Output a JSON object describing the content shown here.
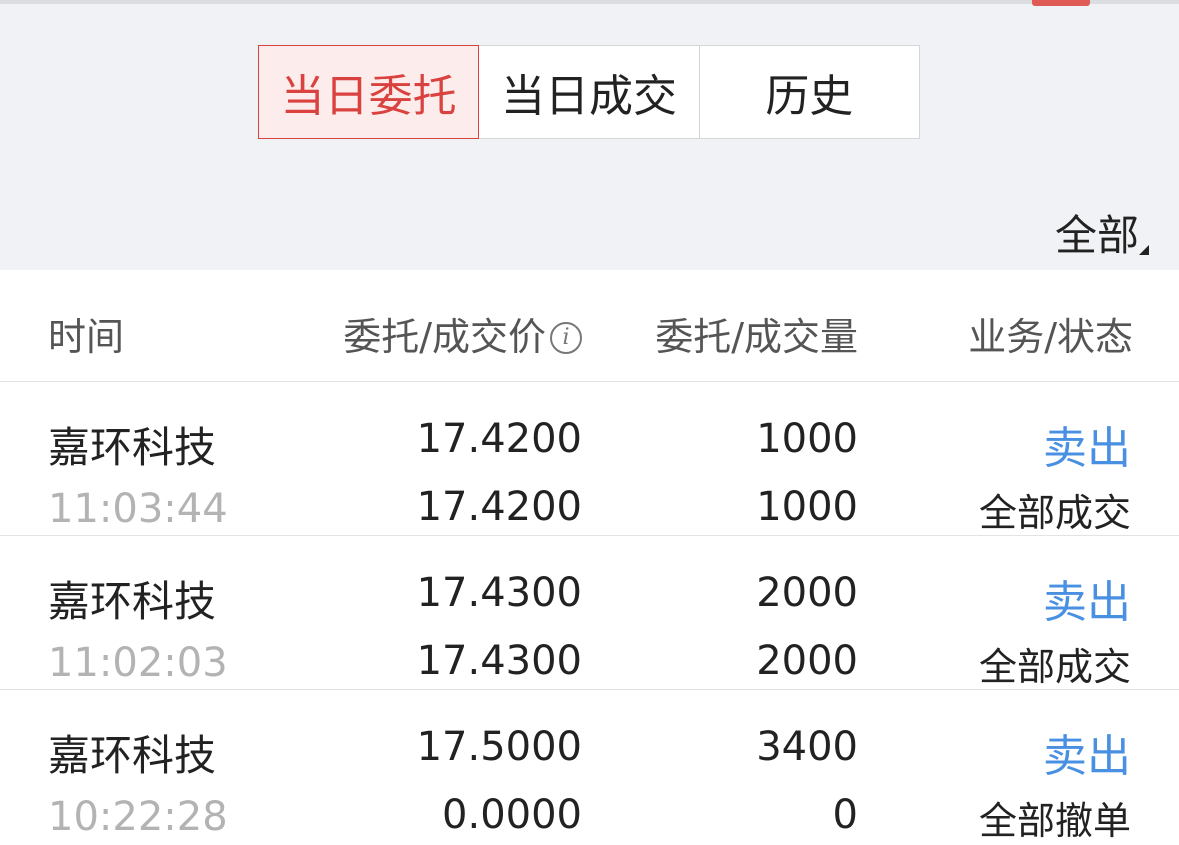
{
  "tabs": [
    {
      "label": "当日委托",
      "active": true
    },
    {
      "label": "当日成交",
      "active": false
    },
    {
      "label": "历史",
      "active": false
    }
  ],
  "filter": {
    "label": "全部"
  },
  "header": {
    "time": "时间",
    "price": "委托/成交价",
    "quantity": "委托/成交量",
    "status": "业务/状态",
    "info_icon": "i"
  },
  "orders": [
    {
      "name": "嘉环科技",
      "time": "11:03:44",
      "order_price": "17.4200",
      "deal_price": "17.4200",
      "order_qty": "1000",
      "deal_qty": "1000",
      "action": "卖出",
      "status": "全部成交"
    },
    {
      "name": "嘉环科技",
      "time": "11:02:03",
      "order_price": "17.4300",
      "deal_price": "17.4300",
      "order_qty": "2000",
      "deal_qty": "2000",
      "action": "卖出",
      "status": "全部成交"
    },
    {
      "name": "嘉环科技",
      "time": "10:22:28",
      "order_price": "17.5000",
      "deal_price": "0.0000",
      "order_qty": "3400",
      "deal_qty": "0",
      "action": "卖出",
      "status": "全部撤单"
    }
  ],
  "colors": {
    "accent_red": "#d9423e",
    "action_blue": "#4a90e2",
    "muted_time": "#b3b3b3"
  }
}
